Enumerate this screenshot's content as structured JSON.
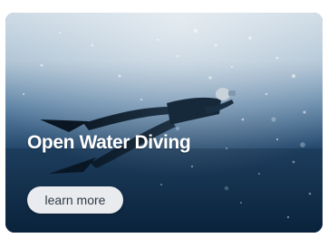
{
  "card": {
    "title": "Open Water Diving",
    "cta_label": "learn more",
    "image_subject": "freediver-swimming-underwater"
  },
  "colors": {
    "surface_light": "#c9d8e4",
    "water_mid": "#2c5a82",
    "water_deep": "#0b2540",
    "button_bg": "#e9ebee",
    "button_text": "#2e3a46",
    "title_text": "#ffffff"
  }
}
